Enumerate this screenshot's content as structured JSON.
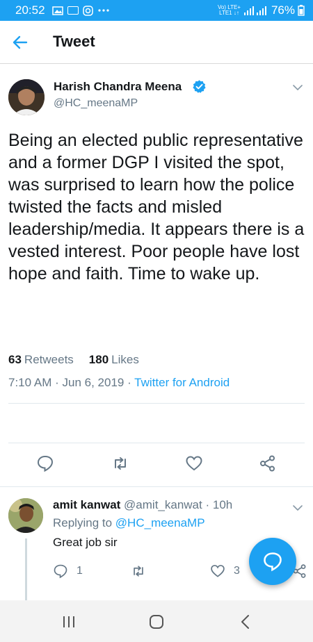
{
  "status_bar": {
    "time": "20:52",
    "lte_line1": "Vo) LTE+",
    "lte_line2": "LTE1 ↓↑",
    "battery": "76%"
  },
  "header": {
    "title": "Tweet"
  },
  "tweet": {
    "author_name": "Harish Chandra Meena",
    "author_handle": "@HC_meenaMP",
    "text": "Being an elected public representative and a former DGP I visited the spot, was surprised to learn how the police twisted the facts and misled leadership/media. It appears there is a vested interest. Poor people have lost hope and faith. Time to wake up.",
    "time": "7:10 AM",
    "date": "Jun 6, 2019",
    "source": "Twitter for Android",
    "retweets_count": "63",
    "retweets_label": "Retweets",
    "likes_count": "180",
    "likes_label": "Likes"
  },
  "reply": {
    "name": "amit kanwat",
    "handle": "@amit_kanwat",
    "age": "10h",
    "replying_prefix": "Replying to",
    "replying_to": "@HC_meenaMP",
    "text": "Great job sir",
    "reply_count": "1",
    "like_count": "3"
  },
  "colors": {
    "accent": "#1da1f2",
    "text": "#14171a",
    "muted": "#657786"
  },
  "icons": [
    "back-arrow-icon",
    "verified-icon",
    "chevron-down-icon",
    "reply-icon",
    "retweet-icon",
    "like-icon",
    "share-icon",
    "compose-reply-icon",
    "nav-recents-icon",
    "nav-home-icon",
    "nav-back-icon"
  ]
}
